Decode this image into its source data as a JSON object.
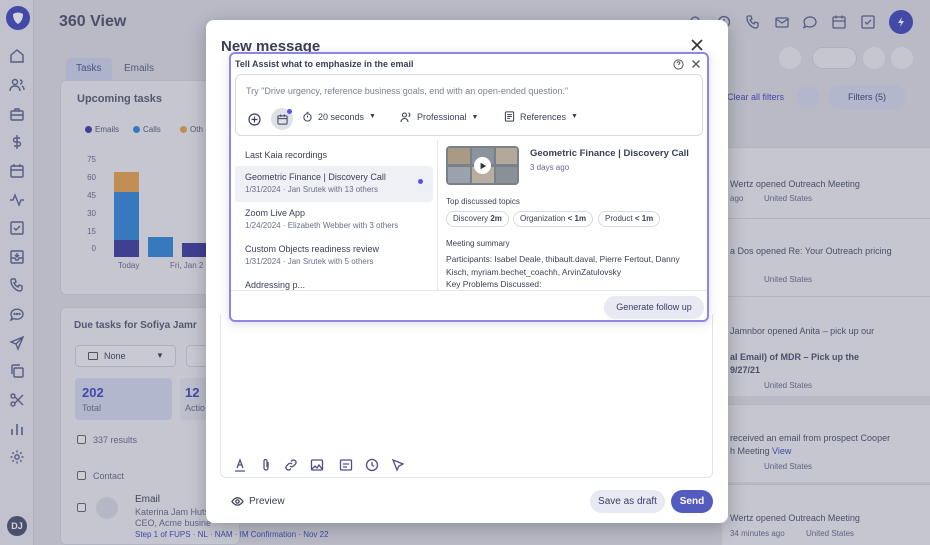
{
  "app": {
    "title": "360 View"
  },
  "sidebar": {
    "avatar_initials": "DJ",
    "icons": [
      "home-icon",
      "contacts-icon",
      "briefcase-icon",
      "dollar-icon",
      "calendar-icon",
      "pulse-icon",
      "checkbox-icon",
      "inbox-icon",
      "phone-icon",
      "chat-icon",
      "send-icon",
      "copy-icon",
      "scissors-icon",
      "bar-chart-icon",
      "settings-icon"
    ]
  },
  "background": {
    "tabs": [
      "Tasks",
      "Emails"
    ],
    "upcoming_title": "Upcoming tasks",
    "legend": [
      {
        "label": "Emails",
        "color": "#3b3a9e"
      },
      {
        "label": "Calls",
        "color": "#2e86d6"
      },
      {
        "label": "Oth",
        "color": "#e6a24b"
      }
    ],
    "chart_ticks": [
      "75",
      "60",
      "45",
      "30",
      "15",
      "0"
    ],
    "x_ticks": [
      "Today",
      "Fri, Jan 2"
    ],
    "clear_filters": "Clear all filters",
    "filters_label": "Filters (5)",
    "due_title": "Due tasks for Sofiya Jamr",
    "none_select": "None",
    "stat_total_value": "202",
    "stat_total_label": "Total",
    "stat_action_value": "12",
    "stat_action_label": "Actio",
    "results": "337 results",
    "contact_header": "Contact",
    "row_type": "Email",
    "row_name": "Katerina Jam Huts",
    "row_role": "CEO, Acme busine",
    "row_step": "Step 1 of FUPS · NL · NAM · IM Confirmation · Nov 22",
    "feed": [
      {
        "line1": "Wertz opened Outreach Meeting",
        "line2": "ago",
        "country": "United States"
      },
      {
        "line1": "a Dos opened Re: Your Outreach pricing",
        "line2": "",
        "country": "United States"
      },
      {
        "line1": "Jamnbor opened Anita – pick up our",
        "line2": "al Email) of MDR – Pick up the",
        "line3": "9/27/21",
        "country": "United States"
      },
      {
        "line1": "received an email from prospect Cooper",
        "line2": "h Meeting",
        "link": "View",
        "country": "United States"
      },
      {
        "line1": "Wertz opened Outreach Meeting",
        "line2": "34 minutes ago",
        "country": "United States"
      }
    ]
  },
  "modal": {
    "title": "New message",
    "preview": "Preview",
    "save_draft": "Save as draft",
    "send": "Send"
  },
  "assist": {
    "title": "Tell Assist what to emphasize in the email",
    "placeholder": "Try \"Drive urgency, reference business goals, end with an open-ended question.\"",
    "duration": "20 seconds",
    "tone": "Professional",
    "references": "References",
    "list_header": "Last Kaia recordings",
    "recordings": [
      {
        "title": "Geometric Finance | Discovery Call",
        "meta": "1/31/2024 · Jan Srutek with 13 others"
      },
      {
        "title": "Zoom Live App",
        "meta": "1/24/2024 · Elizabeth Webber with 3 others"
      },
      {
        "title": "Custom Objects readiness review",
        "meta": "1/31/2024 · Jan Srutek with 5 others"
      },
      {
        "title": "Addressing p...",
        "meta": ""
      }
    ],
    "detail": {
      "title": "Geometric Finance | Discovery Call",
      "ago": "3 days ago",
      "topics_label": "Top discussed topics",
      "topics": [
        {
          "name": "Discovery",
          "dur": "2m"
        },
        {
          "name": "Organization",
          "dur": "< 1m"
        },
        {
          "name": "Product",
          "dur": "< 1m"
        }
      ],
      "summary_label": "Meeting summary",
      "summary": "Participants: Isabel Deale, thibault.daval, Pierre Fertout, Danny Kisch, myriam.bechet_coachh, ArvinZatulovsky",
      "summary2": "Key Problems Discussed:"
    },
    "generate": "Generate follow up"
  }
}
